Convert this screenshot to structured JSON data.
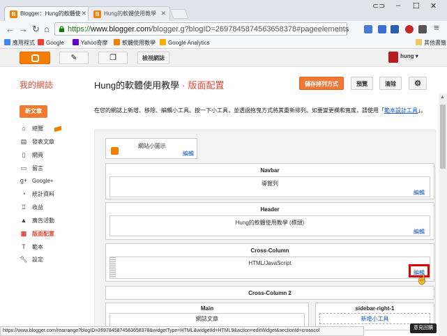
{
  "browser": {
    "tabs": [
      {
        "label": "Blogger：Hung的軟體使",
        "active": true
      },
      {
        "label": "Hung的軟體使用教學",
        "active": false
      }
    ],
    "url_scheme": "https://",
    "url_host": "www.blogger.com",
    "url_path": "/blogger.g?blogID=2697845874563658378#pageelements",
    "bookmarks": [
      {
        "label": "應用程式",
        "color": "#4285f4"
      },
      {
        "label": "Google",
        "color": "#ea4335"
      },
      {
        "label": "Yahoo奇摩",
        "color": "#6001d2"
      },
      {
        "label": "軟體使用教學",
        "color": "#f57d00"
      },
      {
        "label": "Google Analytics",
        "color": "#f9ab00"
      }
    ],
    "other_bookmarks": "其他書籤",
    "status_url": "https://www.blogger.com/rearrange?blogID=2697845874563658378&widgetType=HTML&widgetId=HTML9&action=editWidget&sectionId=crosscol"
  },
  "blogger_bar": {
    "view_blog": "檢視網誌",
    "user": "hung"
  },
  "header": {
    "my_blogs": "我的網誌",
    "blog_title": "Hung的軟體使用教學",
    "separator": "·",
    "page_name": "版面配置",
    "save_arrangement": "儲存排列方式",
    "preview": "預覽",
    "clear": "清除"
  },
  "sidebar": {
    "new_post": "新文章",
    "items": [
      {
        "label": "總覽",
        "icon": "home-icon"
      },
      {
        "label": "發表文章",
        "icon": "posts-icon"
      },
      {
        "label": "網頁",
        "icon": "pages-icon"
      },
      {
        "label": "留言",
        "icon": "comments-icon"
      },
      {
        "label": "Google+",
        "icon": "google-plus-icon"
      },
      {
        "label": "統計資料",
        "icon": "stats-icon"
      },
      {
        "label": "收益",
        "icon": "trophy-icon"
      },
      {
        "label": "廣告活動",
        "icon": "campaigns-icon"
      },
      {
        "label": "版面配置",
        "icon": "layout-icon",
        "active": true
      },
      {
        "label": "範本",
        "icon": "template-icon"
      },
      {
        "label": "設定",
        "icon": "wrench-icon"
      }
    ]
  },
  "main": {
    "intro_text": "在您的網誌上新增、移除、編輯小工具。按一下小工具，並透過拖曳方式將其重新排列。如要變更欄和寬度，請使用「",
    "intro_link": "範本設計工具",
    "intro_end": "」。",
    "favicon": {
      "title": "網站小圖示",
      "edit": "編輯"
    },
    "sections": [
      {
        "title": "Navbar",
        "gadget": "導覽列",
        "edit": "編輯"
      },
      {
        "title": "Header",
        "gadget": "Hung的軟體使用教學 (標頭)",
        "edit": "編輯"
      },
      {
        "title": "Cross-Column",
        "gadget": "HTML/JavaScript",
        "edit": "編輯"
      }
    ],
    "cross_column_2": "Cross-Column 2",
    "main_column": {
      "title": "Main",
      "gadget": "網誌文章"
    },
    "sidebar_right": {
      "title": "sidebar-right-1",
      "add": "新增小工具"
    }
  },
  "feedback": "意見回饋",
  "colors": {
    "brand_orange": "#f57d00",
    "accent_red": "#dd4b39",
    "link_blue": "#1155cc",
    "highlight": "#e00000"
  }
}
